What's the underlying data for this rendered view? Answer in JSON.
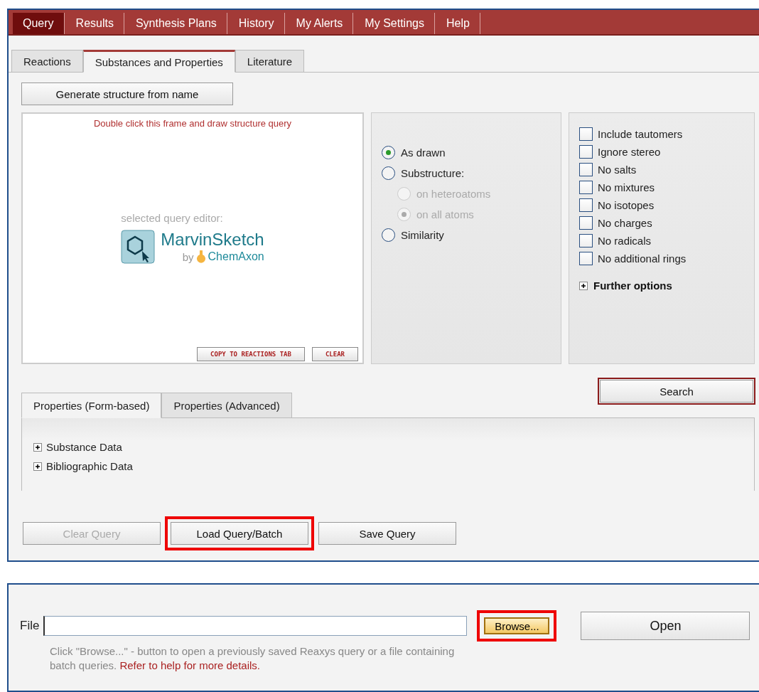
{
  "nav_tabs": [
    {
      "label": "Query",
      "selected": true
    },
    {
      "label": "Results",
      "selected": false
    },
    {
      "label": "Synthesis Plans",
      "selected": false
    },
    {
      "label": "History",
      "selected": false
    },
    {
      "label": "My Alerts",
      "selected": false
    },
    {
      "label": "My Settings",
      "selected": false
    },
    {
      "label": "Help",
      "selected": false
    }
  ],
  "sub_tabs": [
    {
      "label": "Reactions",
      "selected": false
    },
    {
      "label": "Substances and Properties",
      "selected": true
    },
    {
      "label": "Literature",
      "selected": false
    }
  ],
  "generate_button": "Generate structure from name",
  "sketch_frame": {
    "hint": "Double click this frame and draw structure query",
    "editor_label": "selected query editor:",
    "logo_name": "MarvinSketch",
    "logo_by": "by",
    "logo_vendor": "ChemAxon",
    "buttons": [
      "COPY TO REACTIONS TAB",
      "CLEAR"
    ]
  },
  "search_modes": [
    {
      "label": "As drawn",
      "selected": true,
      "disabled": false,
      "kind": "main"
    },
    {
      "label": "Substructure:",
      "selected": false,
      "disabled": false,
      "kind": "main"
    },
    {
      "label": "on heteroatoms",
      "selected": false,
      "disabled": true,
      "kind": "sub"
    },
    {
      "label": "on all atoms",
      "selected": true,
      "disabled": true,
      "kind": "sub"
    },
    {
      "label": "Similarity",
      "selected": false,
      "disabled": false,
      "kind": "main"
    }
  ],
  "options": [
    {
      "label": "Include tautomers",
      "checked": false
    },
    {
      "label": "Ignore stereo",
      "checked": false
    },
    {
      "label": "No salts",
      "checked": false
    },
    {
      "label": "No mixtures",
      "checked": false
    },
    {
      "label": "No isotopes",
      "checked": false
    },
    {
      "label": "No charges",
      "checked": false
    },
    {
      "label": "No radicals",
      "checked": false
    },
    {
      "label": "No additional rings",
      "checked": false
    }
  ],
  "further_options": {
    "label": "Further options",
    "expanded": false
  },
  "search_button": "Search",
  "property_tabs": [
    {
      "label": "Properties (Form-based)",
      "selected": true
    },
    {
      "label": "Properties (Advanced)",
      "selected": false
    }
  ],
  "property_groups": [
    {
      "label": "Substance Data",
      "expanded": false
    },
    {
      "label": "Bibliographic Data",
      "expanded": false
    }
  ],
  "query_buttons": [
    {
      "label": "Clear Query",
      "disabled": true,
      "highlighted": false
    },
    {
      "label": "Load Query/Batch",
      "disabled": false,
      "highlighted": true
    },
    {
      "label": "Save Query",
      "disabled": false,
      "highlighted": false
    }
  ],
  "file_dialog": {
    "label": "File",
    "browse": {
      "label": "Browse...",
      "highlighted": true
    },
    "open": "Open",
    "help": "Click \"Browse...\" - button to open a previously saved Reaxys query or a file containing batch queries.",
    "help_link": "Refer to help for more details."
  }
}
